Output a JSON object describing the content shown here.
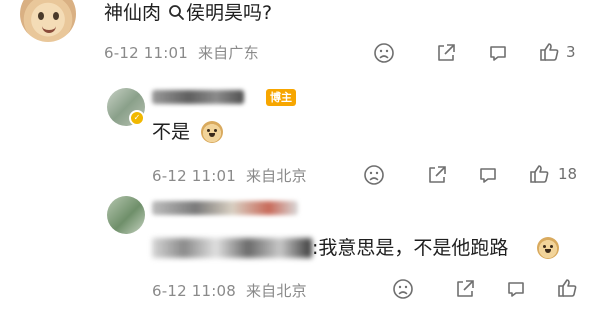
{
  "comments": [
    {
      "text": "神仙肉 ",
      "search_query": "侯明昊吗?",
      "time": "6-12 11:01",
      "location": "来自广东",
      "like_count": "3"
    },
    {
      "badge": "博主",
      "text": "不是",
      "time": "6-12 11:01",
      "location": "来自北京",
      "like_count": "18"
    },
    {
      "text": ":我意思是，不是他跑路",
      "time": "6-12 11:08",
      "location": "来自北京",
      "like_count": ""
    }
  ],
  "icons": {
    "dislike": "frown-face-icon",
    "share": "share-icon",
    "comment": "comment-icon",
    "like": "thumbs-up-icon",
    "search": "search-icon",
    "verified": "verified-badge-icon",
    "emoji": "doge-emoji-icon"
  },
  "colors": {
    "badge_bg": "#f7a600",
    "meta_text": "#8a8a8a",
    "icon": "#6f6f6f",
    "verified": "#f1b800"
  }
}
